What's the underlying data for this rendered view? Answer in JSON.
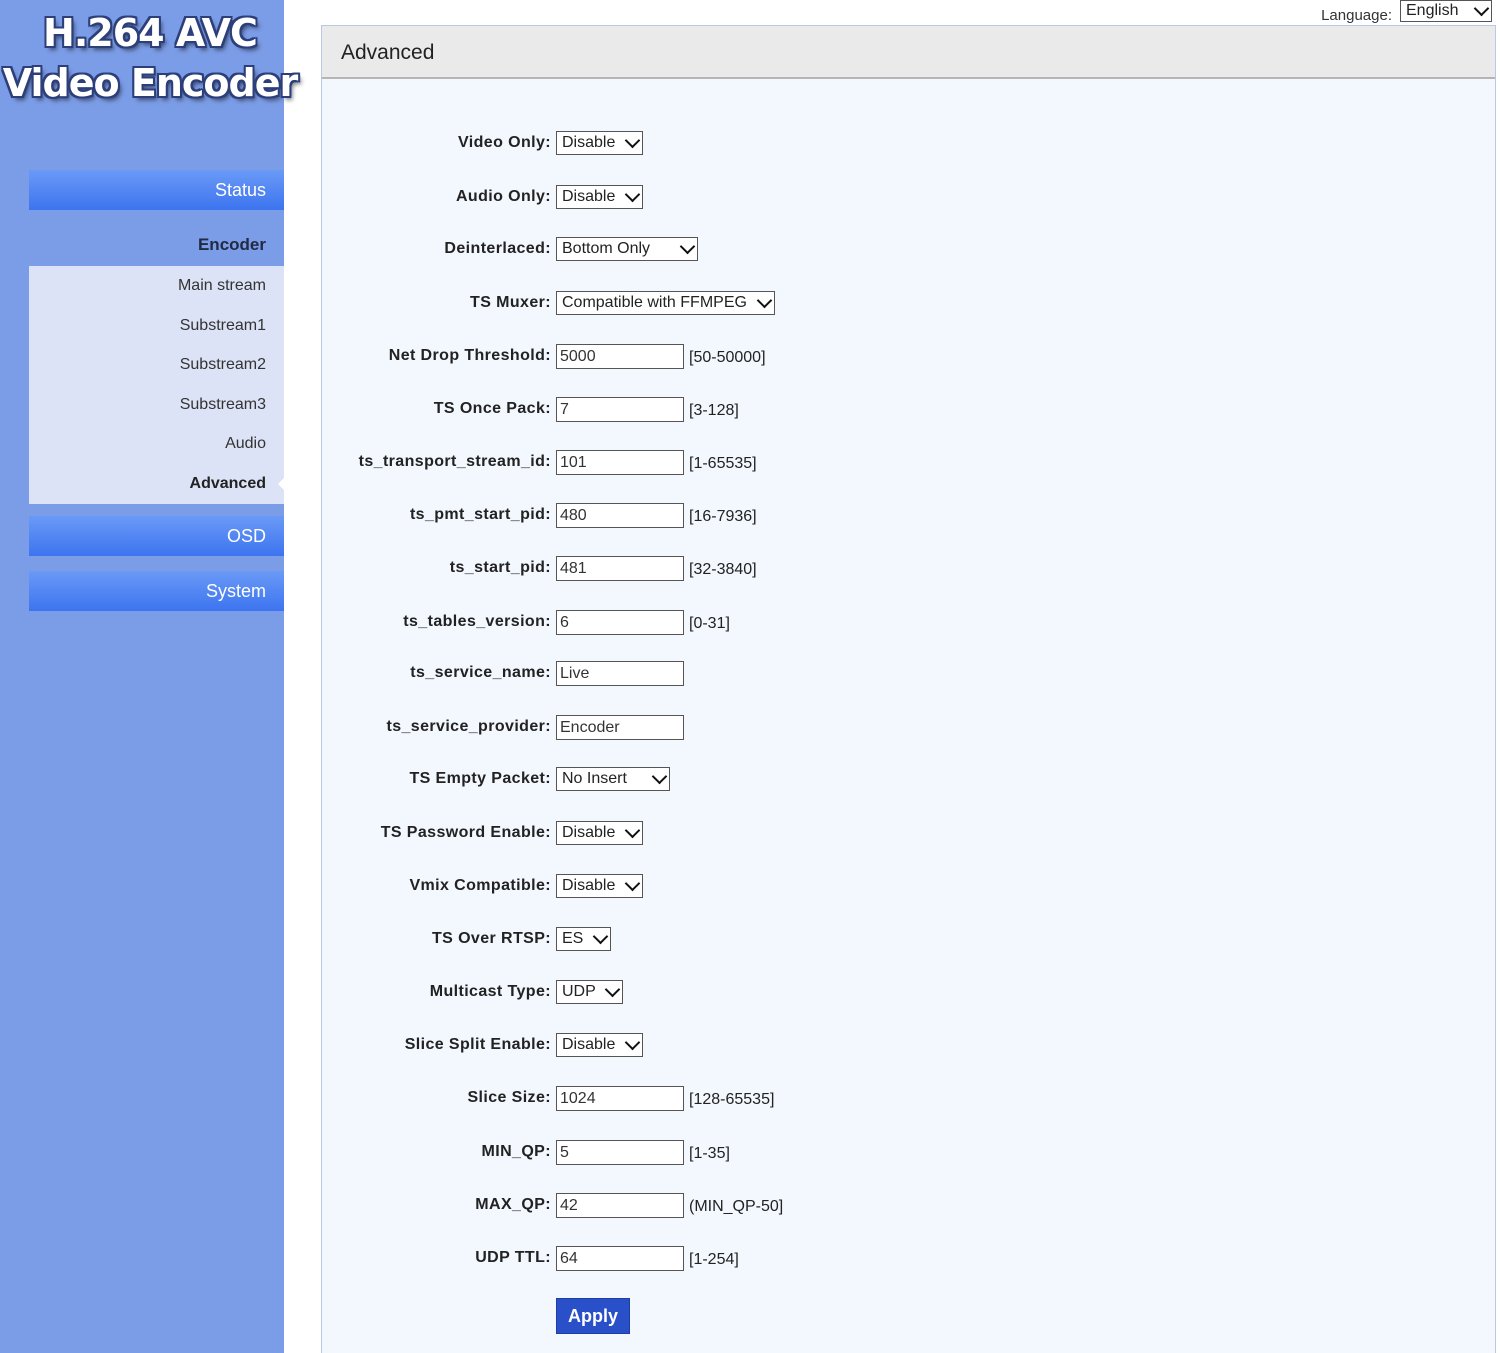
{
  "logo": {
    "line1": "H.264 AVC",
    "line2": "Video Encoder"
  },
  "language": {
    "label": "Language:",
    "value": "English"
  },
  "nav": {
    "status": "Status",
    "encoder": "Encoder",
    "submenu": [
      "Main stream",
      "Substream1",
      "Substream2",
      "Substream3",
      "Audio",
      "Advanced"
    ],
    "osd": "OSD",
    "system": "System"
  },
  "panel": {
    "title": "Advanced"
  },
  "fields": [
    {
      "label": "Video Only:",
      "type": "select",
      "value": "Disable"
    },
    {
      "label": "Audio Only:",
      "type": "select",
      "value": "Disable"
    },
    {
      "label": "Deinterlaced:",
      "type": "select",
      "value": "Bottom Only"
    },
    {
      "label": "TS Muxer:",
      "type": "select",
      "value": "Compatible with FFMPEG"
    },
    {
      "label": "Net Drop Threshold:",
      "type": "input",
      "value": "5000",
      "range": "[50-50000]"
    },
    {
      "label": "TS Once Pack:",
      "type": "input",
      "value": "7",
      "range": "[3-128]"
    },
    {
      "label": "ts_transport_stream_id:",
      "type": "input",
      "value": "101",
      "range": "[1-65535]"
    },
    {
      "label": "ts_pmt_start_pid:",
      "type": "input",
      "value": "480",
      "range": "[16-7936]"
    },
    {
      "label": "ts_start_pid:",
      "type": "input",
      "value": "481",
      "range": "[32-3840]"
    },
    {
      "label": "ts_tables_version:",
      "type": "input",
      "value": "6",
      "range": "[0-31]"
    },
    {
      "label": "ts_service_name:",
      "type": "input",
      "value": "Live",
      "range": ""
    },
    {
      "label": "ts_service_provider:",
      "type": "input",
      "value": "Encoder",
      "range": ""
    },
    {
      "label": "TS Empty Packet:",
      "type": "select",
      "value": "No Insert"
    },
    {
      "label": "TS Password Enable:",
      "type": "select",
      "value": "Disable"
    },
    {
      "label": "Vmix Compatible:",
      "type": "select",
      "value": "Disable"
    },
    {
      "label": "TS Over RTSP:",
      "type": "select",
      "value": "ES"
    },
    {
      "label": "Multicast Type:",
      "type": "select",
      "value": "UDP"
    },
    {
      "label": "Slice Split Enable:",
      "type": "select",
      "value": "Disable"
    },
    {
      "label": "Slice Size:",
      "type": "input",
      "value": "1024",
      "range": "[128-65535]"
    },
    {
      "label": "MIN_QP:",
      "type": "input",
      "value": "5",
      "range": "[1-35]"
    },
    {
      "label": "MAX_QP:",
      "type": "input",
      "value": "42",
      "range": "(MIN_QP-50]"
    },
    {
      "label": "UDP TTL:",
      "type": "input",
      "value": "64",
      "range": "[1-254]"
    }
  ],
  "apply_label": "Apply"
}
